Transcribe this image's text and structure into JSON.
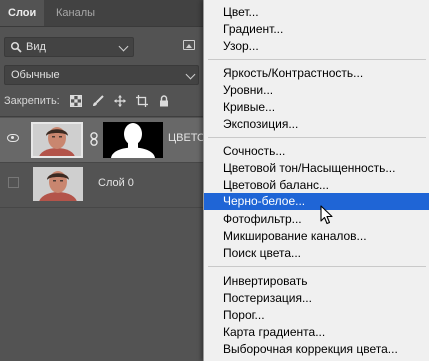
{
  "tabs": [
    {
      "label": "Слои",
      "active": true
    },
    {
      "label": "Каналы",
      "active": false
    }
  ],
  "filter": {
    "value": "Вид",
    "icon": "search-icon"
  },
  "blend_mode": {
    "value": "Обычные"
  },
  "lock": {
    "label": "Закрепить:"
  },
  "layers": [
    {
      "name": "ЦВЕТО",
      "visible": true,
      "selected": true,
      "has_mask": true
    },
    {
      "name": "Слой 0",
      "visible": false,
      "selected": false,
      "has_mask": false
    }
  ],
  "menu": {
    "groups": [
      [
        "Цвет...",
        "Градиент...",
        "Узор..."
      ],
      [
        "Яркость/Контрастность...",
        "Уровни...",
        "Кривые...",
        "Экспозиция..."
      ],
      [
        "Сочность...",
        "Цветовой тон/Насыщенность...",
        "Цветовой баланс...",
        "Черно-белое...",
        "Фотофильтр...",
        "Микширование каналов...",
        "Поиск цвета..."
      ],
      [
        "Инвертировать",
        "Постеризация...",
        "Порог...",
        "Карта градиента...",
        "Выборочная коррекция цвета..."
      ]
    ],
    "highlighted": "Черно-белое..."
  },
  "colors": {
    "panel_bg": "#535353",
    "selected_layer_bg": "#686868",
    "menu_bg": "#f0f0f0",
    "menu_highlight": "#1f65d6"
  }
}
